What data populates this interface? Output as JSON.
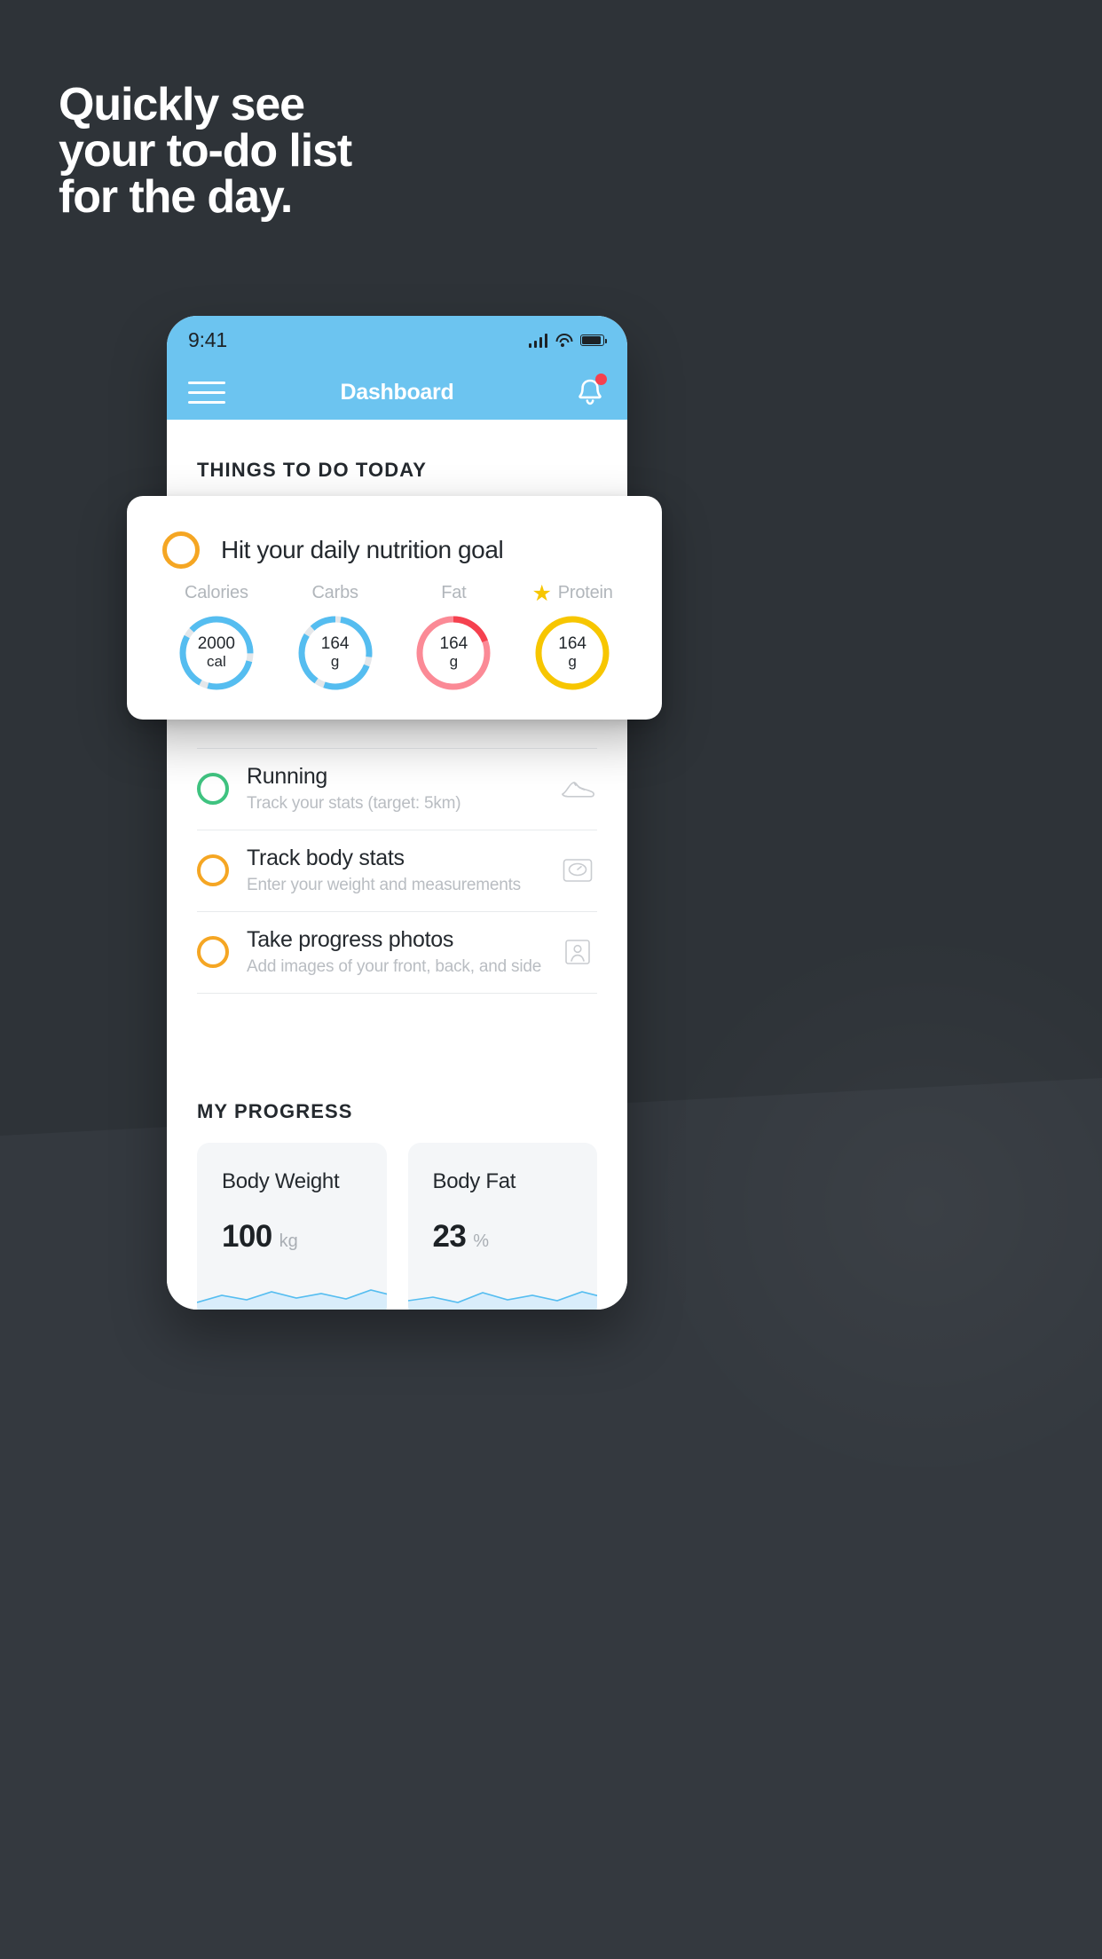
{
  "headline": {
    "line1": "Quickly see",
    "line2": "your to-do list",
    "line3": "for the day."
  },
  "colors": {
    "background": "#2e3338",
    "header_blue": "#6cc4f0",
    "ring_orange": "#f5a623",
    "ring_green": "#3fc380",
    "ring_blue": "#55bdf0",
    "ring_pink": "#fb8a96",
    "ring_red": "#f5414f",
    "ring_gold": "#f7c600",
    "badge_red": "#f5414f"
  },
  "phone": {
    "status_bar": {
      "time": "9:41",
      "signal_icon": "cellular-bars-icon",
      "wifi_icon": "wifi-icon",
      "battery_icon": "battery-icon"
    },
    "nav": {
      "menu_icon": "hamburger-menu-icon",
      "title": "Dashboard",
      "bell_icon": "notification-bell-icon",
      "has_badge": true
    },
    "sections": {
      "todo_title": "THINGS TO DO TODAY",
      "progress_title": "MY PROGRESS"
    },
    "nutrition_card": {
      "checkbox_icon": "circle-checkbox-icon",
      "title": "Hit your daily nutrition goal",
      "nutrients": [
        {
          "label": "Calories",
          "value": "2000",
          "unit": "cal",
          "color": "#55bdf0",
          "track": "#e4e7ea",
          "percent": 88,
          "starred": false
        },
        {
          "label": "Carbs",
          "value": "164",
          "unit": "g",
          "color": "#55bdf0",
          "track": "#e4e7ea",
          "percent": 86,
          "starred": false
        },
        {
          "label": "Fat",
          "value": "164",
          "unit": "g",
          "color": "#fb8a96",
          "track": "#f5414f",
          "percent": 82,
          "starred": false
        },
        {
          "label": "Protein",
          "value": "164",
          "unit": "g",
          "color": "#f7c600",
          "track": "#f7c600",
          "percent": 100,
          "starred": true
        }
      ],
      "star_icon": "star-icon"
    },
    "tasks": [
      {
        "title": "Running",
        "subtitle": "Track your stats (target: 5km)",
        "ring_color": "green",
        "icon": "running-shoe-icon"
      },
      {
        "title": "Track body stats",
        "subtitle": "Enter your weight and measurements",
        "ring_color": "orange",
        "icon": "weight-scale-icon"
      },
      {
        "title": "Take progress photos",
        "subtitle": "Add images of your front, back, and side",
        "ring_color": "orange",
        "icon": "progress-photo-icon"
      }
    ],
    "progress_cards": [
      {
        "title": "Body Weight",
        "value": "100",
        "unit": "kg"
      },
      {
        "title": "Body Fat",
        "value": "23",
        "unit": "%"
      }
    ]
  }
}
